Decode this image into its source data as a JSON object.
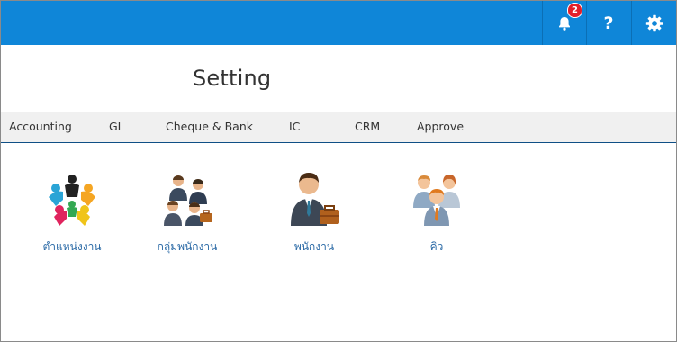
{
  "topbar": {
    "notification_count": "2",
    "help_symbol": "?",
    "icons": [
      "bell-icon",
      "question-icon",
      "gear-icon"
    ],
    "color": "#0f86d8"
  },
  "page": {
    "title": "Setting"
  },
  "tabs": [
    {
      "label": "Accounting"
    },
    {
      "label": "GL"
    },
    {
      "label": "Cheque & Bank"
    },
    {
      "label": "IC"
    },
    {
      "label": "CRM"
    },
    {
      "label": "Approve"
    }
  ],
  "tiles": [
    {
      "label": "ตำแหน่งงาน",
      "icon": "people-circle-icon"
    },
    {
      "label": "กลุ่มพนักงาน",
      "icon": "employee-group-icon"
    },
    {
      "label": "พนักงาน",
      "icon": "employee-icon"
    },
    {
      "label": "คิว",
      "icon": "queue-icon"
    }
  ],
  "colors": {
    "link": "#2b6aa6",
    "tab_bar": "#f0f0f0",
    "badge": "#e3202a"
  }
}
